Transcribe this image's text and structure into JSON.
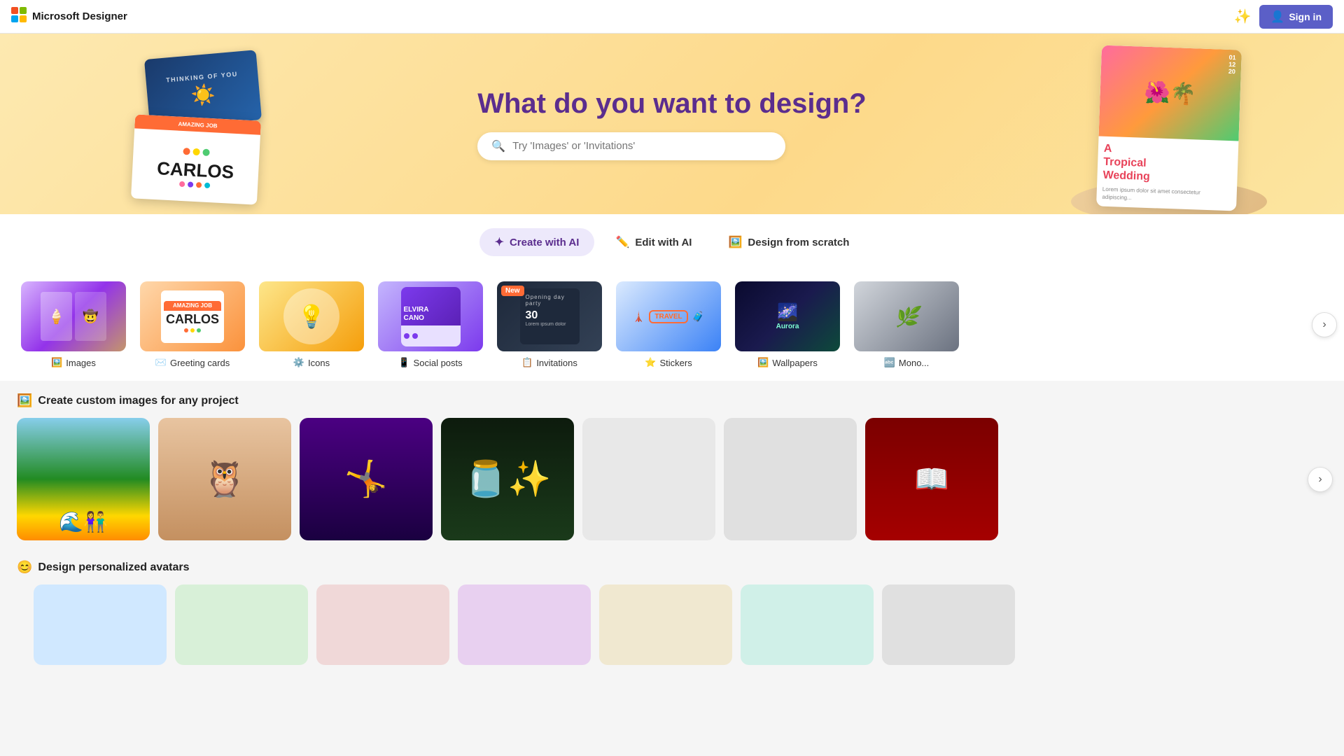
{
  "app": {
    "name": "Microsoft Designer",
    "logo_char": "🎨"
  },
  "nav": {
    "magic_icon": "✨",
    "sign_in_label": "Sign in",
    "sign_in_icon": "👤"
  },
  "hero": {
    "title": "What do you want to design?",
    "search_placeholder": "Try 'Images' or 'Invitations'",
    "left_card_top": "THINKING OF YOU",
    "left_card_bottom_label": "AMAZING JOB",
    "left_card_bottom_text": "CARLOS",
    "right_card_title": "A Tropical Wedding"
  },
  "tabs": [
    {
      "id": "create-ai",
      "label": "Create with AI",
      "icon": "✦",
      "active": true
    },
    {
      "id": "edit-ai",
      "label": "Edit with AI",
      "icon": "✏️",
      "active": false
    },
    {
      "id": "design-scratch",
      "label": "Design from scratch",
      "icon": "🖼️",
      "active": false
    }
  ],
  "design_types": [
    {
      "id": "images",
      "label": "Images",
      "icon": "🖼️",
      "new": false
    },
    {
      "id": "greeting-cards",
      "label": "Greeting cards",
      "icon": "✉️",
      "new": false
    },
    {
      "id": "icons",
      "label": "Icons",
      "icon": "⚙️",
      "new": false
    },
    {
      "id": "social-posts",
      "label": "Social posts",
      "icon": "📱",
      "new": false
    },
    {
      "id": "invitations",
      "label": "Invitations",
      "icon": "📋",
      "new": true
    },
    {
      "id": "stickers",
      "label": "Stickers",
      "icon": "⭐",
      "new": false
    },
    {
      "id": "wallpapers",
      "label": "Wallpapers",
      "icon": "🖼️",
      "new": false
    },
    {
      "id": "monograms",
      "label": "Mono...",
      "icon": "🔤",
      "new": false
    }
  ],
  "custom_images": {
    "section_title": "Create custom images for any project",
    "section_icon": "🖼️",
    "items": [
      {
        "id": "beach",
        "alt": "Beach couple scene",
        "color_class": "img-beach"
      },
      {
        "id": "owl",
        "alt": "Owl on books",
        "color_class": "img-owl"
      },
      {
        "id": "gymnast",
        "alt": "Gymnast superhero",
        "color_class": "img-gymnast"
      },
      {
        "id": "jar",
        "alt": "Glowing jar",
        "color_class": "img-jar"
      },
      {
        "id": "empty1",
        "alt": "Loading",
        "color_class": "img-empty1"
      },
      {
        "id": "empty2",
        "alt": "Loading",
        "color_class": "img-empty2"
      },
      {
        "id": "book",
        "alt": "Decorative book",
        "color_class": "img-book"
      }
    ]
  },
  "avatars": {
    "section_title": "Design personalized avatars",
    "section_icon": "😊"
  },
  "carousel_arrow": "›"
}
